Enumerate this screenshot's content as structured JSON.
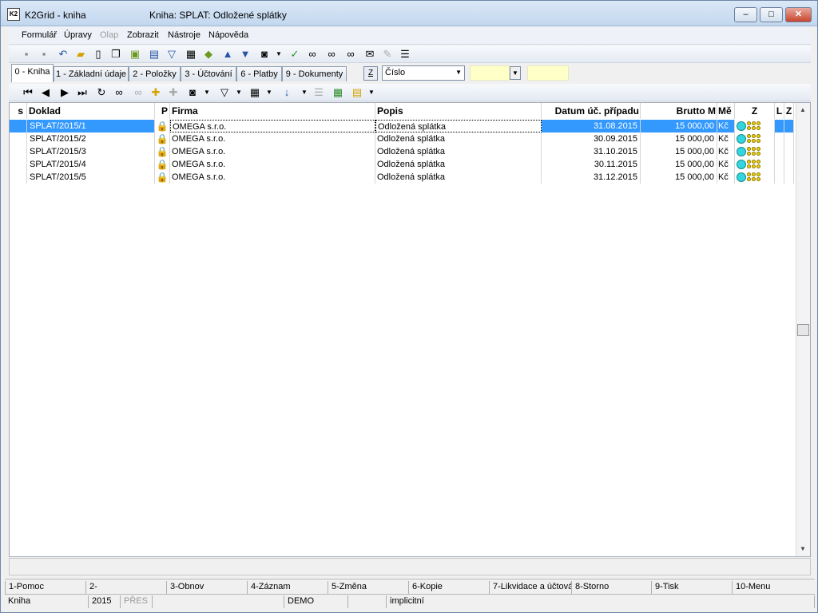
{
  "window": {
    "app_title": "K2Grid - kniha",
    "document_title": "Kniha: SPLAT: Odložené splátky",
    "minimize": "–",
    "maximize": "□",
    "close": "✕"
  },
  "menu": [
    "Formulář",
    "Úpravy",
    "Olap",
    "Zobrazit",
    "Nástroje",
    "Nápověda"
  ],
  "tabs": [
    "0 - Kniha",
    "1 - Základní údaje",
    "2 - Položky",
    "3 - Účtování",
    "6 - Platby",
    "9 - Dokumenty"
  ],
  "filter": {
    "z_button": "Z",
    "sort_field": "Číslo"
  },
  "grid": {
    "columns": [
      "s",
      "Doklad",
      "P",
      "Firma",
      "Popis",
      "Datum úč. případu",
      "Brutto M",
      "Mě",
      "Z",
      "L",
      "Z"
    ],
    "rows": [
      {
        "doklad": "SPLAT/2015/1",
        "firma": "OMEGA s.r.o.",
        "popis": "Odložená splátka",
        "datum": "31.08.2015",
        "brutto": "15 000,00",
        "mena": "Kč"
      },
      {
        "doklad": "SPLAT/2015/2",
        "firma": "OMEGA s.r.o.",
        "popis": "Odložená splátka",
        "datum": "30.09.2015",
        "brutto": "15 000,00",
        "mena": "Kč"
      },
      {
        "doklad": "SPLAT/2015/3",
        "firma": "OMEGA s.r.o.",
        "popis": "Odložená splátka",
        "datum": "31.10.2015",
        "brutto": "15 000,00",
        "mena": "Kč"
      },
      {
        "doklad": "SPLAT/2015/4",
        "firma": "OMEGA s.r.o.",
        "popis": "Odložená splátka",
        "datum": "30.11.2015",
        "brutto": "15 000,00",
        "mena": "Kč"
      },
      {
        "doklad": "SPLAT/2015/5",
        "firma": "OMEGA s.r.o.",
        "popis": "Odložená splátka",
        "datum": "31.12.2015",
        "brutto": "15 000,00",
        "mena": "Kč"
      }
    ]
  },
  "function_keys": [
    "1-Pomoc",
    "2-",
    "3-Obnov",
    "4-Záznam",
    "5-Změna",
    "6-Kopie",
    "7-Likvidace a účtová",
    "8-Storno",
    "9-Tisk",
    "10-Menu"
  ],
  "status": [
    "Kniha",
    "2015",
    "PŘES",
    "DEMO",
    "implicitní"
  ],
  "icons": {
    "toolbar1": [
      "save-icon",
      "save-as-icon",
      "undo-icon",
      "open-folder-icon",
      "new-document-icon",
      "copy-icon",
      "lock-icon",
      "book-icon",
      "filter-icon",
      "print-preview-icon",
      "stack-icon",
      "arrow-up-icon",
      "arrow-down-icon",
      "camera-icon",
      "mark-icon",
      "binoculars-icon",
      "find-next-icon",
      "find-prev-icon",
      "mail-icon",
      "edit-icon",
      "list-icon"
    ],
    "toolbar2": [
      "first-record-icon",
      "prev-record-icon",
      "next-record-icon",
      "last-record-icon",
      "refresh-icon",
      "search-icon",
      "search-next-icon",
      "add-icon",
      "delete-icon",
      "camera-icon",
      "filter-icon",
      "export-icon",
      "sort-icon",
      "numbered-list-icon",
      "excel-icon",
      "columns-icon"
    ]
  },
  "colors": {
    "selection": "#3399ff",
    "lock": "#6b9a1f",
    "face": "#33d6e0",
    "dots": "#f1d300"
  }
}
